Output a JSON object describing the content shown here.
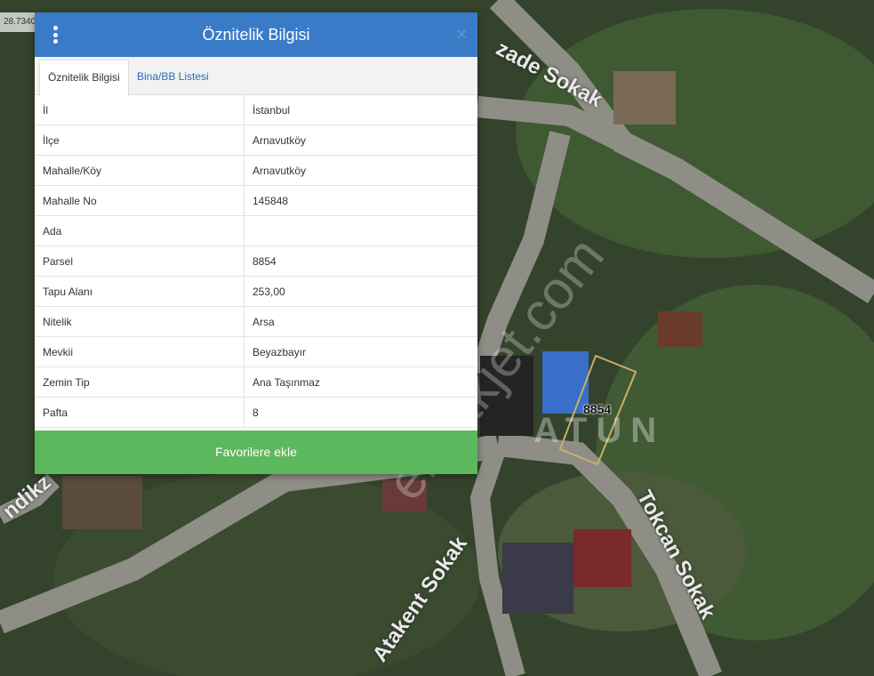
{
  "map": {
    "coordinate": "28.7340",
    "watermark": "emlakjet.com",
    "parcel_label": "8854",
    "area_letters": "ATUN",
    "streets": [
      "zade Sokak",
      "Tokcan Sokak",
      "Atakent Sokak",
      "ndikz"
    ]
  },
  "panel": {
    "title": "Öznitelik Bilgisi",
    "close": "×",
    "tabs": [
      {
        "label": "Öznitelik Bilgisi",
        "active": true
      },
      {
        "label": "Bina/BB Listesi",
        "active": false
      }
    ],
    "rows": [
      {
        "key": "İl",
        "value": "İstanbul"
      },
      {
        "key": "İlçe",
        "value": "Arnavutköy"
      },
      {
        "key": "Mahalle/Köy",
        "value": "Arnavutköy"
      },
      {
        "key": "Mahalle No",
        "value": "145848"
      },
      {
        "key": "Ada",
        "value": ""
      },
      {
        "key": "Parsel",
        "value": "8854"
      },
      {
        "key": "Tapu Alanı",
        "value": "253,00"
      },
      {
        "key": "Nitelik",
        "value": "Arsa"
      },
      {
        "key": "Mevkii",
        "value": "Beyazbayır"
      },
      {
        "key": "Zemin Tip",
        "value": "Ana Taşınmaz"
      },
      {
        "key": "Pafta",
        "value": "8"
      }
    ],
    "favorite_button": "Favorilere ekle"
  },
  "colors": {
    "header": "#3a7bc8",
    "button": "#5cb85c",
    "link": "#2a6ebb"
  }
}
